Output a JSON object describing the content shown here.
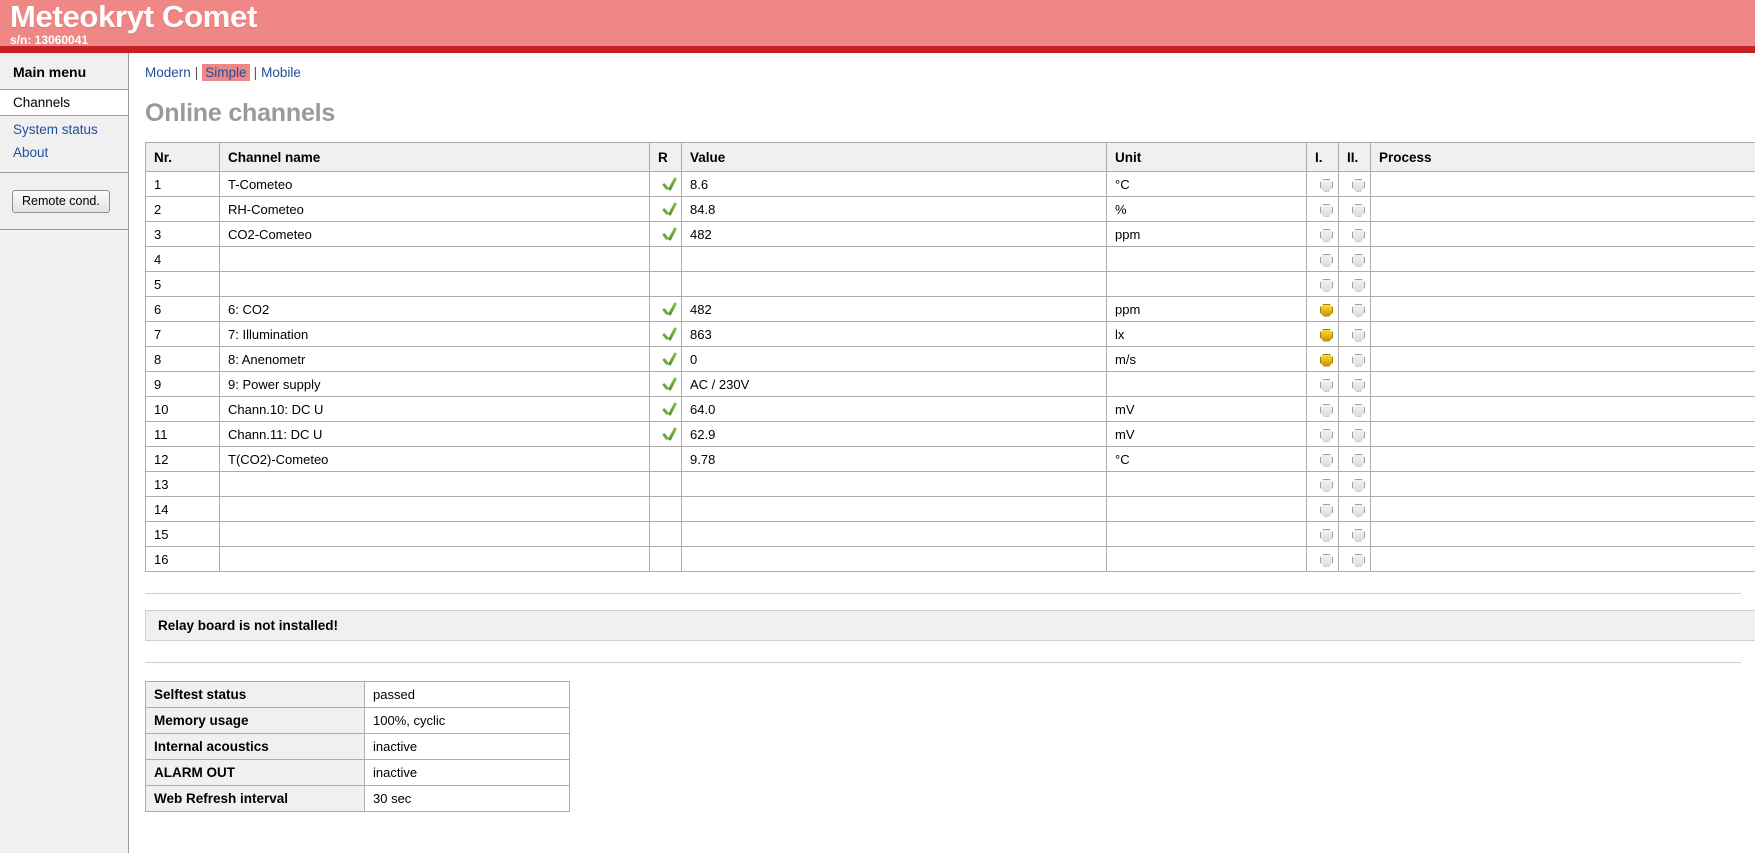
{
  "header": {
    "title": "Meteokryt Comet",
    "serial": "s/n: 13060041",
    "band_color": "#ef8787",
    "rule_color": "#c42127"
  },
  "sidebar": {
    "title": "Main menu",
    "items": [
      {
        "label": "Channels",
        "current": true
      },
      {
        "label": "System status",
        "current": false
      },
      {
        "label": "About",
        "current": false
      }
    ],
    "button": {
      "label": "Remote cond."
    }
  },
  "viewnav": {
    "items": [
      {
        "label": "Modern",
        "active": false
      },
      {
        "label": "Simple",
        "active": true
      },
      {
        "label": "Mobile",
        "active": false
      }
    ],
    "separator": "|",
    "active_color": "#ef8787"
  },
  "main": {
    "page_title": "Online channels"
  },
  "channels_table": {
    "columns": [
      "Nr.",
      "Channel name",
      "R",
      "Value",
      "Unit",
      "I.",
      "II.",
      "Process"
    ],
    "rows": [
      {
        "nr": "1",
        "name": "T-Cometeo",
        "r": true,
        "value": "8.6",
        "unit": "°C",
        "i": false,
        "ii": false,
        "process": ""
      },
      {
        "nr": "2",
        "name": "RH-Cometeo",
        "r": true,
        "value": "84.8",
        "unit": "%",
        "i": false,
        "ii": false,
        "process": ""
      },
      {
        "nr": "3",
        "name": "CO2-Cometeo",
        "r": true,
        "value": "482",
        "unit": "ppm",
        "i": false,
        "ii": false,
        "process": ""
      },
      {
        "nr": "4",
        "name": "",
        "r": false,
        "value": "",
        "unit": "",
        "i": false,
        "ii": false,
        "process": ""
      },
      {
        "nr": "5",
        "name": "",
        "r": false,
        "value": "",
        "unit": "",
        "i": false,
        "ii": false,
        "process": ""
      },
      {
        "nr": "6",
        "name": "6: CO2",
        "r": true,
        "value": "482",
        "unit": "ppm",
        "i": true,
        "ii": false,
        "process": ""
      },
      {
        "nr": "7",
        "name": "7: Illumination",
        "r": true,
        "value": "863",
        "unit": "lx",
        "i": true,
        "ii": false,
        "process": ""
      },
      {
        "nr": "8",
        "name": "8: Anenometr",
        "r": true,
        "value": "0",
        "unit": "m/s",
        "i": true,
        "ii": false,
        "process": ""
      },
      {
        "nr": "9",
        "name": "9: Power supply",
        "r": true,
        "value": "AC / 230V",
        "unit": "",
        "i": false,
        "ii": false,
        "process": ""
      },
      {
        "nr": "10",
        "name": "Chann.10: DC U",
        "r": true,
        "value": "64.0",
        "unit": "mV",
        "i": false,
        "ii": false,
        "process": ""
      },
      {
        "nr": "11",
        "name": "Chann.11: DC U",
        "r": true,
        "value": "62.9",
        "unit": "mV",
        "i": false,
        "ii": false,
        "process": ""
      },
      {
        "nr": "12",
        "name": "T(CO2)-Cometeo",
        "r": false,
        "value": "9.78",
        "unit": "°C",
        "i": false,
        "ii": false,
        "process": ""
      },
      {
        "nr": "13",
        "name": "",
        "r": false,
        "value": "",
        "unit": "",
        "i": false,
        "ii": false,
        "process": ""
      },
      {
        "nr": "14",
        "name": "",
        "r": false,
        "value": "",
        "unit": "",
        "i": false,
        "ii": false,
        "process": ""
      },
      {
        "nr": "15",
        "name": "",
        "r": false,
        "value": "",
        "unit": "",
        "i": false,
        "ii": false,
        "process": ""
      },
      {
        "nr": "16",
        "name": "",
        "r": false,
        "value": "",
        "unit": "",
        "i": false,
        "ii": false,
        "process": ""
      }
    ]
  },
  "relay_notice": {
    "text": "Relay board is not installed!"
  },
  "status_table": {
    "rows": [
      {
        "label": "Selftest status",
        "value": "passed"
      },
      {
        "label": "Memory usage",
        "value": "100%, cyclic"
      },
      {
        "label": "Internal acoustics",
        "value": "inactive"
      },
      {
        "label": "ALARM OUT",
        "value": "inactive"
      },
      {
        "label": "Web Refresh interval",
        "value": "30 sec"
      }
    ]
  },
  "icons": {
    "check": "check-icon",
    "led_off": "led-indicator-off-icon",
    "led_on": "led-indicator-on-icon"
  }
}
